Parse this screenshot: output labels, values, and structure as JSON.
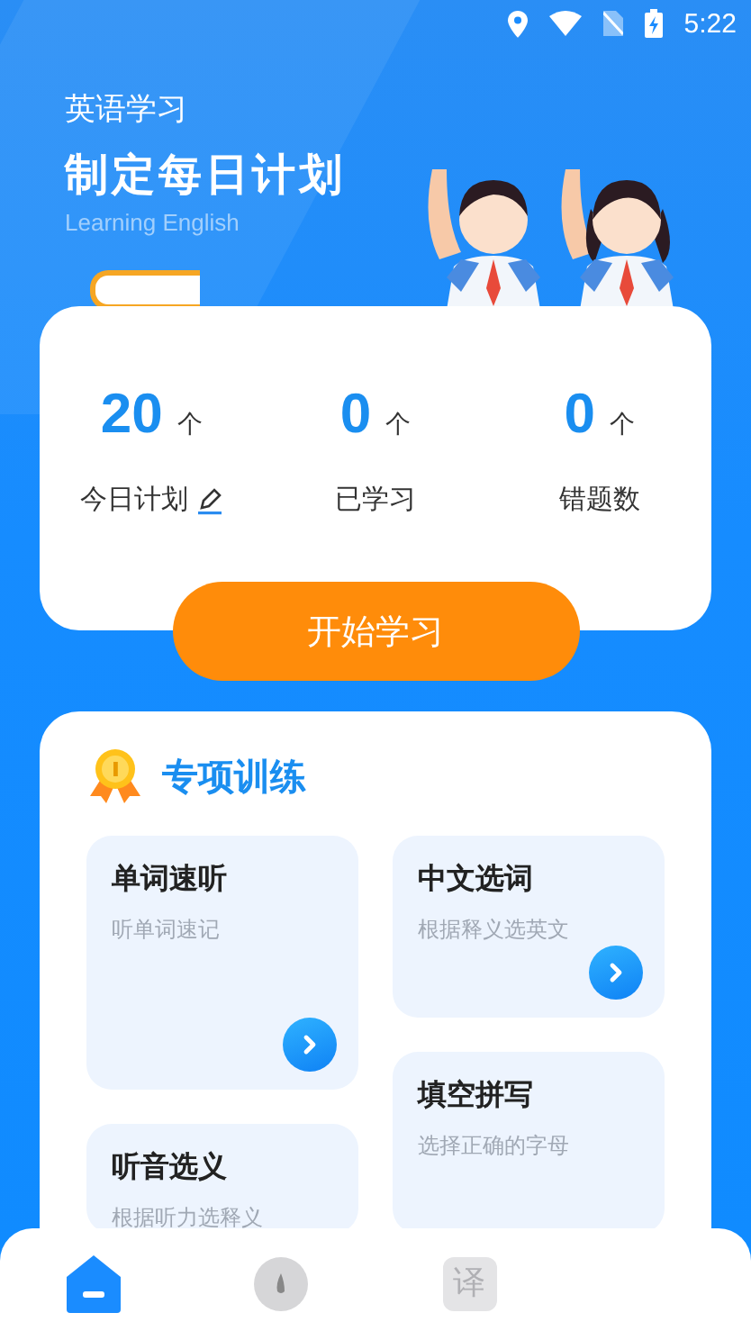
{
  "status_bar": {
    "time": "5:22"
  },
  "header": {
    "subtitle": "英语学习",
    "title": "制定每日计划",
    "caption": "Learning English"
  },
  "stats": [
    {
      "value": "20",
      "unit": "个",
      "label": "今日计划",
      "editable": true
    },
    {
      "value": "0",
      "unit": "个",
      "label": "已学习",
      "editable": false
    },
    {
      "value": "0",
      "unit": "个",
      "label": "错题数",
      "editable": false
    }
  ],
  "start_button": "开始学习",
  "training": {
    "title": "专项训练",
    "columns": [
      {
        "cards": [
          {
            "title": "单词速听",
            "subtitle": "听单词速记",
            "kind": "tall"
          },
          {
            "title": "听音选义",
            "subtitle": "根据听力选释义",
            "kind": "cut"
          }
        ]
      },
      {
        "cards": [
          {
            "title": "中文选词",
            "subtitle": "根据释义选英文",
            "kind": "short"
          },
          {
            "title": "填空拼写",
            "subtitle": "选择正确的字母",
            "kind": "cut"
          }
        ]
      }
    ]
  },
  "bottom_nav": [
    {
      "kind": "home",
      "selected": true
    },
    {
      "kind": "drop",
      "selected": false
    },
    {
      "kind": "text",
      "label": "译",
      "selected": false
    }
  ]
}
